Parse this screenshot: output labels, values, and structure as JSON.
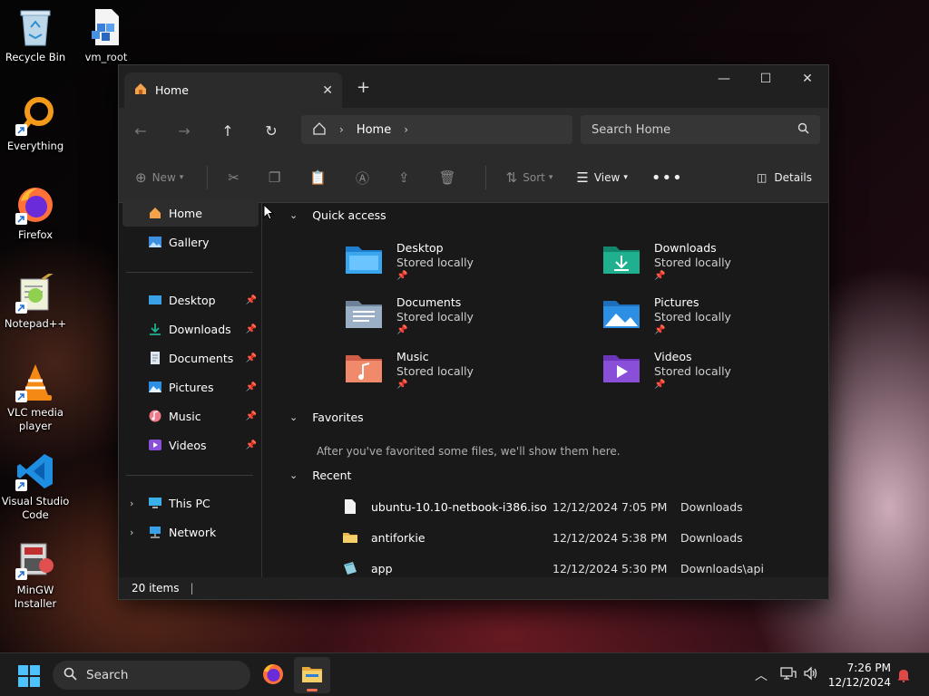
{
  "desktop": {
    "icons": [
      {
        "label": "Recycle Bin",
        "icon": "recycle-bin-icon"
      },
      {
        "label": "vm_root",
        "icon": "file-icon"
      },
      {
        "label": "Everything",
        "icon": "everything-search-icon"
      },
      {
        "label": "Firefox",
        "icon": "firefox-icon"
      },
      {
        "label": "Notepad++",
        "icon": "notepadpp-icon"
      },
      {
        "label": "VLC media player",
        "icon": "vlc-icon"
      },
      {
        "label": "Visual Studio Code",
        "icon": "vscode-icon"
      },
      {
        "label": "MinGW Installer",
        "icon": "mingw-icon"
      }
    ]
  },
  "window": {
    "tab_title": "Home",
    "breadcrumb": [
      "Home"
    ],
    "search_placeholder": "Search Home",
    "toolbar": {
      "new": "New",
      "sort": "Sort",
      "view": "View",
      "details": "Details"
    },
    "sidebar": {
      "top": [
        {
          "label": "Home",
          "selected": true
        },
        {
          "label": "Gallery"
        }
      ],
      "pinned": [
        {
          "label": "Desktop"
        },
        {
          "label": "Downloads"
        },
        {
          "label": "Documents"
        },
        {
          "label": "Pictures"
        },
        {
          "label": "Music"
        },
        {
          "label": "Videos"
        }
      ],
      "locations": [
        {
          "label": "This PC"
        },
        {
          "label": "Network"
        }
      ]
    },
    "sections": {
      "quick_access": "Quick access",
      "favorites": "Favorites",
      "favorites_empty": "After you've favorited some files, we'll show them here.",
      "recent": "Recent"
    },
    "quick_access": [
      {
        "name": "Desktop",
        "status": "Stored locally"
      },
      {
        "name": "Downloads",
        "status": "Stored locally"
      },
      {
        "name": "Documents",
        "status": "Stored locally"
      },
      {
        "name": "Pictures",
        "status": "Stored locally"
      },
      {
        "name": "Music",
        "status": "Stored locally"
      },
      {
        "name": "Videos",
        "status": "Stored locally"
      }
    ],
    "recent": [
      {
        "name": "ubuntu-10.10-netbook-i386.iso",
        "date": "12/12/2024 7:05 PM",
        "location": "Downloads"
      },
      {
        "name": "antiforkie",
        "date": "12/12/2024 5:38 PM",
        "location": "Downloads"
      },
      {
        "name": "app",
        "date": "12/12/2024 5:30 PM",
        "location": "Downloads\\api"
      }
    ],
    "status": "20 items"
  },
  "taskbar": {
    "search_placeholder": "Search",
    "time": "7:26 PM",
    "date": "12/12/2024"
  },
  "colors": {
    "desktop_blue": "#3aa0e8",
    "downloads_green": "#1fb08f",
    "documents_gray": "#8aa0b8",
    "pictures_blue": "#2c8fe3",
    "music_orange": "#f07a5a",
    "videos_purple": "#8a4fd8",
    "folder_yellow": "#e8b94a"
  }
}
